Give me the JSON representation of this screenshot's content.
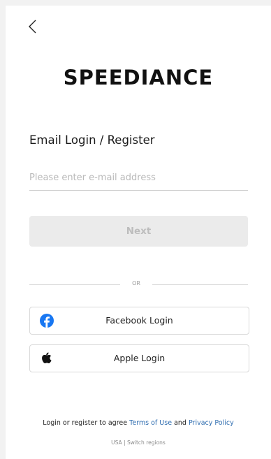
{
  "header": {
    "back_icon": "chevron-left-icon"
  },
  "brand": {
    "name": "SPEEDIANCE"
  },
  "login": {
    "title": "Email Login / Register",
    "email_placeholder": "Please enter e-mail address",
    "email_value": "",
    "next_label": "Next",
    "next_enabled": false
  },
  "divider": {
    "text": "OR"
  },
  "social": {
    "facebook": {
      "label": "Facebook Login",
      "icon": "facebook-icon",
      "color": "#1877F2"
    },
    "apple": {
      "label": "Apple Login",
      "icon": "apple-icon",
      "color": "#111111"
    }
  },
  "footer": {
    "agree_prefix": "Login or register to agree",
    "terms_label": "Terms of Use",
    "and_text": "and",
    "privacy_label": "Privacy Policy",
    "link_color": "#2F6DB0",
    "region": "USA",
    "region_separator": "|",
    "switch_label": "Switch regions"
  }
}
